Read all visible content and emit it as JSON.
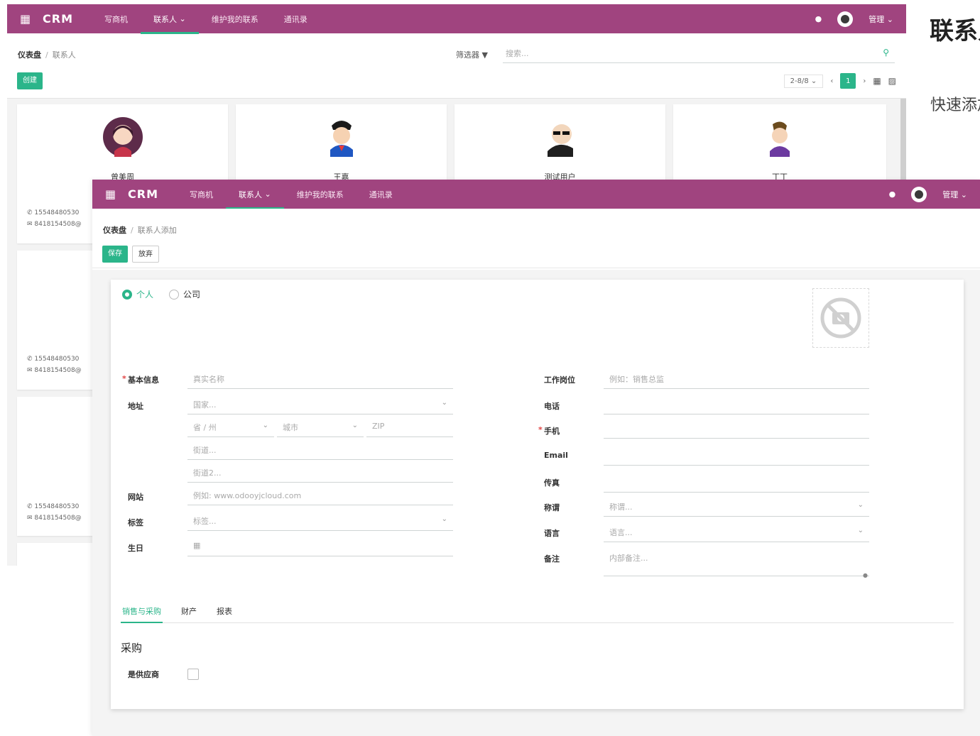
{
  "back": {
    "app_name": "CRM",
    "menu": [
      "写商机",
      "联系人",
      "维护我的联系",
      "通讯录"
    ],
    "breadcrumb_root": "仪表盘",
    "breadcrumb_current": "联系人",
    "create": "创建",
    "filter": "筛选器",
    "search_placeholder": "搜索...",
    "user": "管理",
    "pager_range": "2-8/8",
    "page": "1",
    "cards": [
      {
        "name": "曾美周",
        "phone": "15548480530",
        "email": "8418154508@"
      },
      {
        "name": "王嘉",
        "phone": "",
        "email": ""
      },
      {
        "name": "测试用户",
        "phone": "",
        "email": ""
      },
      {
        "name": "丁丁",
        "phone": "",
        "email": ""
      }
    ],
    "left_phones": [
      "15548480530",
      "15548480530",
      "15548480530"
    ],
    "left_emails": [
      "8418154508@",
      "8418154508@",
      "8418154508@"
    ]
  },
  "front": {
    "app_name": "CRM",
    "menu": [
      "写商机",
      "联系人",
      "维护我的联系",
      "通讯录"
    ],
    "breadcrumb_root": "仪表盘",
    "breadcrumb_current": "联系人添加",
    "save": "保存",
    "discard": "放弃",
    "user": "管理",
    "radio_person": "个人",
    "radio_company": "公司",
    "labels": {
      "basic": "基本信息",
      "address": "地址",
      "website": "网站",
      "tags": "标签",
      "birthday": "生日",
      "job": "工作岗位",
      "phone": "电话",
      "mobile": "手机",
      "email": "Email",
      "fax": "传真",
      "title": "称谓",
      "lang": "语言",
      "note": "备注"
    },
    "placeholders": {
      "basic": "真实名称",
      "country": "国家...",
      "state": "省 / 州",
      "city": "城市",
      "zip": "ZIP",
      "street": "街道...",
      "street2": "街道2...",
      "website": "例如: www.odooyjcloud.com",
      "tags": "标签...",
      "job": "例如：销售总监",
      "title": "称谓...",
      "lang": "语言...",
      "note": "内部备注..."
    },
    "tabs": [
      "销售与采购",
      "财产",
      "报表"
    ],
    "section": "采购",
    "checkbox_label": "是供应商"
  },
  "side": {
    "title": "联系人添",
    "subtitle": "快速添加联系"
  },
  "colors": {
    "brand": "#a0447f",
    "accent": "#2bb58a"
  }
}
